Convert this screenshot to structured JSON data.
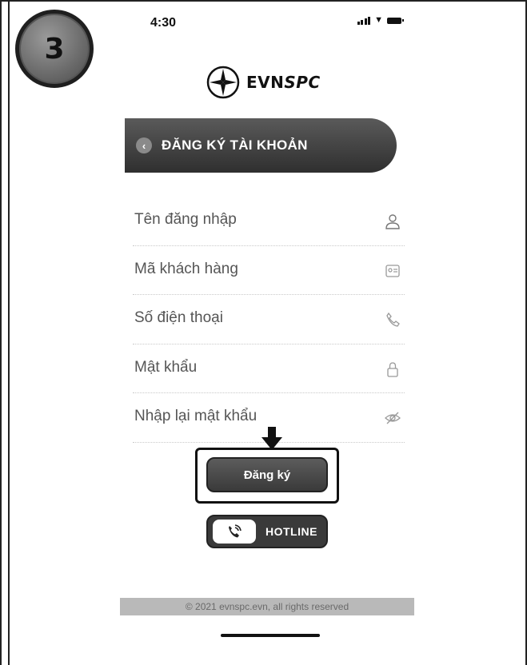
{
  "tutorial": {
    "step_number": "3"
  },
  "status_bar": {
    "time": "4:30"
  },
  "brand": {
    "name_prefix": "EVN",
    "name_suffix": "SPC"
  },
  "header": {
    "title": "ĐĂNG KÝ TÀI KHOẢN",
    "back_icon": "chevron-left-icon"
  },
  "form": {
    "fields": [
      {
        "label": "Tên đăng nhập",
        "icon": "user-icon"
      },
      {
        "label": "Mã khách hàng",
        "icon": "id-icon"
      },
      {
        "label": "Số điện thoại",
        "icon": "phone-icon"
      },
      {
        "label": "Mật khẩu",
        "icon": "lock-icon"
      },
      {
        "label": "Nhập lại mật khẩu",
        "icon": "eye-off-icon"
      }
    ]
  },
  "actions": {
    "register_label": "Đăng ký",
    "hotline_label": "HOTLINE"
  },
  "footer": {
    "copyright": "© 2021 evnspc.evn, all rights reserved"
  },
  "colors": {
    "header_bg": "#3a3a3a",
    "button_bg": "#4a4a4a",
    "badge_bg": "#7a7a7a"
  }
}
